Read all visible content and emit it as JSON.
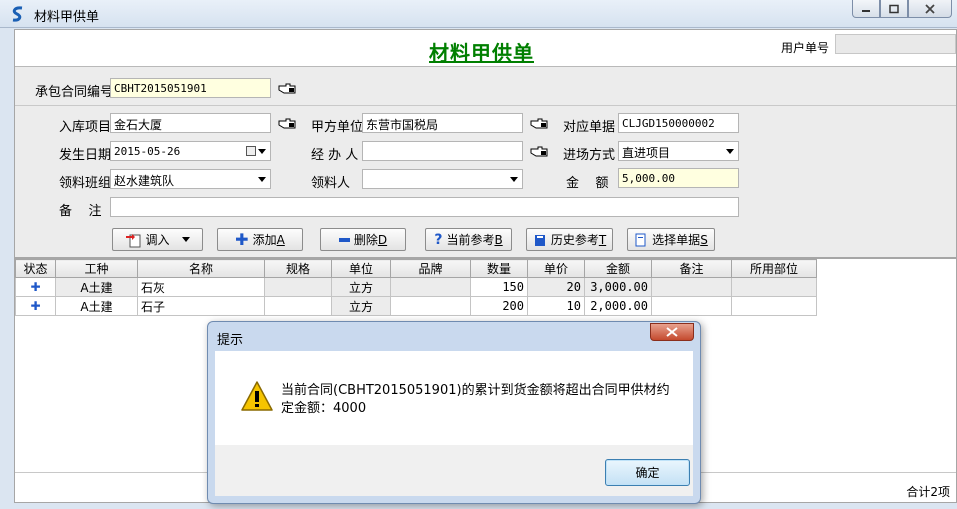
{
  "window": {
    "title": "材料甲供单"
  },
  "header": {
    "form_title": "材料甲供单",
    "user_no_label": "用户单号",
    "user_no_value": ""
  },
  "form": {
    "contract_label": "承包合同编号",
    "contract_value": "CBHT2015051901",
    "project_label": "入库项目",
    "project_value": "金石大厦",
    "owner_label": "甲方单位",
    "owner_value": "东营市国税局",
    "ref_doc_label": "对应单据",
    "ref_doc_value": "CLJGD150000002",
    "date_label": "发生日期",
    "date_value": "2015-05-26",
    "handler_label": "经 办 人",
    "handler_value": "",
    "entry_mode_label": "进场方式",
    "entry_mode_value": "直进项目",
    "team_label": "领料班组",
    "team_value": "赵水建筑队",
    "receiver_label": "领料人",
    "receiver_value": "",
    "amount_label": "金    额",
    "amount_value": "5,000.00",
    "remark_label": "备    注",
    "remark_value": ""
  },
  "toolbar": {
    "import_label": "调入",
    "add_label": "添加",
    "add_key": "A",
    "delete_label": "删除",
    "delete_key": "D",
    "current_ref_label": "当前参考",
    "current_ref_key": "B",
    "history_ref_label": "历史参考",
    "history_ref_key": "T",
    "select_doc_label": "选择单据",
    "select_doc_key": "S"
  },
  "grid": {
    "columns": [
      "状态",
      "工种",
      "名称",
      "规格",
      "单位",
      "品牌",
      "数量",
      "单价",
      "金额",
      "备注",
      "所用部位"
    ],
    "rows": [
      {
        "status": "+",
        "trade": "A土建",
        "name": "石灰",
        "spec": "",
        "unit": "立方",
        "brand": "",
        "qty": "150",
        "price": "20",
        "amount": "3,000.00",
        "note": "",
        "part": ""
      },
      {
        "status": "+",
        "trade": "A土建",
        "name": "石子",
        "spec": "",
        "unit": "立方",
        "brand": "",
        "qty": "200",
        "price": "10",
        "amount": "2,000.00",
        "note": "",
        "part": ""
      }
    ],
    "total_label": "合计2项"
  },
  "dialog": {
    "title": "提示",
    "message": "当前合同(CBHT2015051901)的累计到货金额将超出合同甲供材约定金额：4000",
    "ok_label": "确定"
  },
  "colors": {
    "title_green": "#007f00",
    "highlight_yellow": "#ffffe0",
    "accent_blue": "#1f58c8"
  }
}
